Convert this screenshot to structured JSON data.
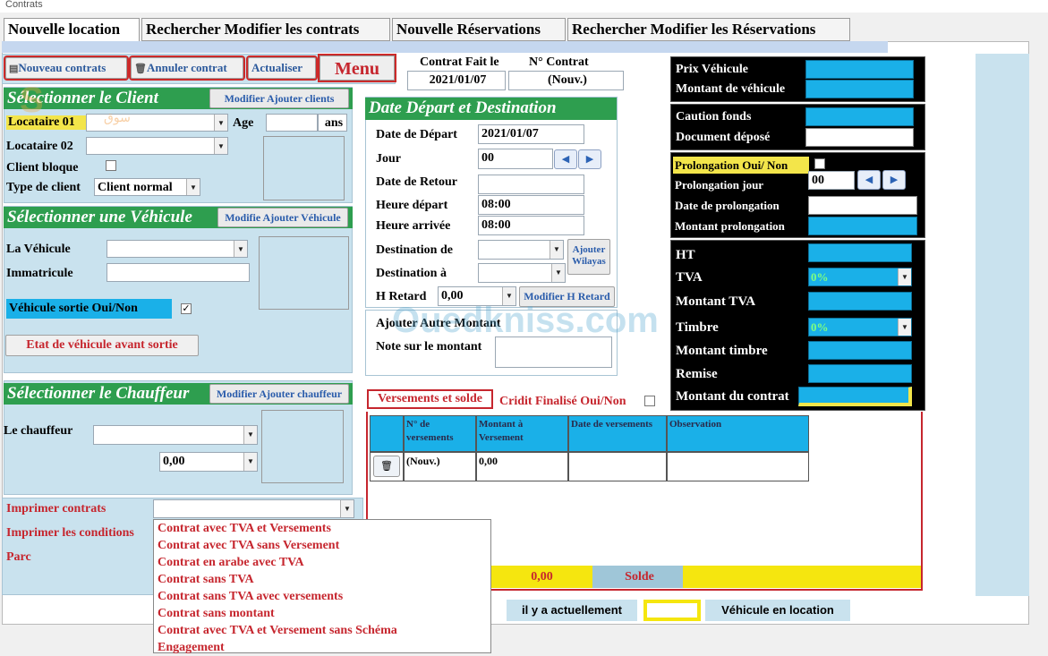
{
  "window": {
    "title": "Contrats"
  },
  "tabs": [
    {
      "label": "Nouvelle location"
    },
    {
      "label": "Rechercher Modifier les contrats"
    },
    {
      "label": "Nouvelle Réservations"
    },
    {
      "label": "Rechercher Modifier les Réservations"
    }
  ],
  "toolbar": {
    "new_contract": "Nouveau contrats",
    "cancel_contract": "Annuler contrat",
    "refresh": "Actualiser",
    "menu": "Menu"
  },
  "contract_header": {
    "date_label": "Contrat Fait le",
    "date_value": "2021/01/07",
    "number_label": "N° Contrat",
    "number_value": "(Nouv.)"
  },
  "client": {
    "title": "Sélectionner le Client",
    "modify_btn": "Modifier Ajouter  clients",
    "locataire1_label": "Locataire 01",
    "age_label": "Age",
    "age_unit": "ans",
    "locataire2_label": "Locataire 02",
    "blocked_label": "Client bloque",
    "type_label": "Type de client",
    "type_value": "Client normal"
  },
  "vehicle": {
    "title": "Sélectionner une Véhicule",
    "modify_btn": "Modifie  Ajouter Véhicule",
    "vehicle_label": "La Véhicule",
    "plate_label": "Immatricule",
    "out_label": "Véhicule sortie Oui/Non",
    "state_btn": "Etat  de véhicule avant sortie"
  },
  "driver": {
    "title": "Sélectionner le Chauffeur",
    "modify_btn": "Modifier Ajouter chauffeur",
    "driver_label": "Le chauffeur",
    "amount_value": "0,00"
  },
  "print": {
    "contracts_label": "Imprimer contrats",
    "conditions_label": "Imprimer les conditions",
    "parc_label": "Parc",
    "options": [
      "Contrat avec TVA et Versements",
      "Contrat avec TVA sans Versement",
      "Contrat en arabe avec TVA",
      "Contrat sans TVA",
      "Contrat sans TVA avec versements",
      "Contrat sans montant",
      "Contrat avec TVA et Versement sans Schéma",
      "Engagement"
    ]
  },
  "departure": {
    "title": "Date Départ et Destination",
    "start_label": "Date de Départ",
    "start_value": "2021/01/07",
    "days_label": "Jour",
    "days_value": "00",
    "return_label": "Date de Retour",
    "dep_time_label": "Heure départ",
    "dep_time_value": "08:00",
    "arr_time_label": "Heure arrivée",
    "arr_time_value": "08:00",
    "dest_from_label": "Destination de",
    "dest_to_label": "Destination à",
    "add_wilaya_btn": "Ajouter Wilayas",
    "delay_label": "H Retard",
    "delay_value": "0,00",
    "delay_btn": "Modifier H Retard"
  },
  "extra": {
    "add_label": "Ajouter Autre Montant",
    "note_label": "Note sur le montant"
  },
  "payments": {
    "title": "Versements et solde",
    "credit_label": "Cridit Finalisé Oui/Non",
    "columns": [
      "N° de versements",
      "Montant  à Versement",
      "Date de versements",
      "Observation"
    ],
    "row": {
      "number": "(Nouv.)",
      "amount": "0,00",
      "date": "",
      "observation": ""
    },
    "total_value": "0,00",
    "solde_label": "Solde"
  },
  "pricing": {
    "prix_label": "Prix Véhicule",
    "montant_label": "Montant de véhicule",
    "caution_label": "Caution fonds",
    "document_label": "Document déposé",
    "prolong_label": "Prolongation Oui/ Non",
    "prolong_days_label": "Prolongation jour",
    "prolong_days_value": "00",
    "prolong_date_label": "Date de prolongation",
    "prolong_amount_label": "Montant  prolongation",
    "ht_label": "HT",
    "tva_label": "TVA",
    "tva_value": "0%",
    "tva_amount_label": "Montant  TVA",
    "timbre_label": "Timbre",
    "timbre_value": "0%",
    "timbre_amount_label": "Montant timbre",
    "remise_label": "Remise",
    "total_label": "Montant du contrat"
  },
  "footer": {
    "currently_label": "il y a actuellement",
    "rented_label": "Véhicule  en location"
  },
  "watermark": {
    "text": "Ouedkniss.com",
    "arabic": "سوق"
  }
}
